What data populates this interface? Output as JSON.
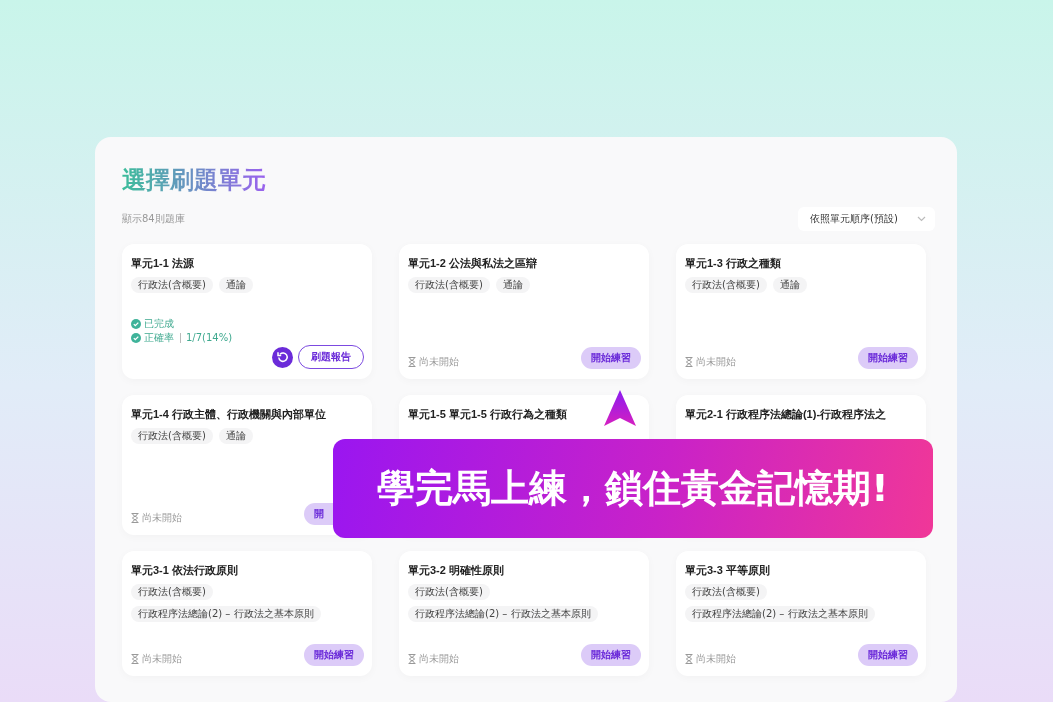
{
  "panel": {
    "title": "選擇刷題單元",
    "count": "顯示84則題庫",
    "sort": {
      "value": "依照單元順序(預設)"
    }
  },
  "units": [
    {
      "title": "單元1-1 法源",
      "tags": [
        "行政法(含概要)",
        "通論"
      ],
      "status": {
        "kind": "done",
        "done_label": "已完成",
        "rate_label": "正確率",
        "rate": "1/7(14%)"
      },
      "actions": [
        {
          "kind": "retry"
        },
        {
          "kind": "outline",
          "label": "刷題報告"
        }
      ]
    },
    {
      "title": "單元1-2 公法與私法之區辯",
      "tags": [
        "行政法(含概要)",
        "通論"
      ],
      "status": {
        "kind": "pending",
        "label": "尚未開始"
      },
      "actions": [
        {
          "kind": "filled",
          "label": "開始練習"
        }
      ]
    },
    {
      "title": "單元1-3 行政之種類",
      "tags": [
        "行政法(含概要)",
        "通論"
      ],
      "status": {
        "kind": "pending",
        "label": "尚未開始"
      },
      "actions": [
        {
          "kind": "filled",
          "label": "開始練習"
        }
      ]
    },
    {
      "title": "單元1-4 行政主體、行政機關與內部單位",
      "tags": [
        "行政法(含概要)",
        "通論"
      ],
      "status": {
        "kind": "pending",
        "label": "尚未開始"
      },
      "actions": [
        {
          "kind": "filled",
          "label": "開"
        }
      ]
    },
    {
      "title": "單元1-5 單元1-5 行政行為之種類"
    },
    {
      "title": "單元2-1 行政程序法總論(1)-行政程序法之"
    },
    {
      "title": "單元3-1 依法行政原則",
      "tags": [
        "行政法(含概要)",
        "行政程序法總論(2) – 行政法之基本原則"
      ],
      "status": {
        "kind": "pending",
        "label": "尚未開始"
      },
      "actions": [
        {
          "kind": "filled",
          "label": "開始練習"
        }
      ]
    },
    {
      "title": "單元3-2 明確性原則",
      "tags": [
        "行政法(含概要)",
        "行政程序法總論(2) – 行政法之基本原則"
      ],
      "status": {
        "kind": "pending",
        "label": "尚未開始"
      },
      "actions": [
        {
          "kind": "filled",
          "label": "開始練習"
        }
      ]
    },
    {
      "title": "單元3-3 平等原則",
      "tags": [
        "行政法(含概要)",
        "行政程序法總論(2) – 行政法之基本原則"
      ],
      "status": {
        "kind": "pending",
        "label": "尚未開始"
      },
      "actions": [
        {
          "kind": "filled",
          "label": "開始練習"
        }
      ]
    }
  ],
  "banner": {
    "text": "學完馬上練，鎖住黃金記憶期!"
  }
}
